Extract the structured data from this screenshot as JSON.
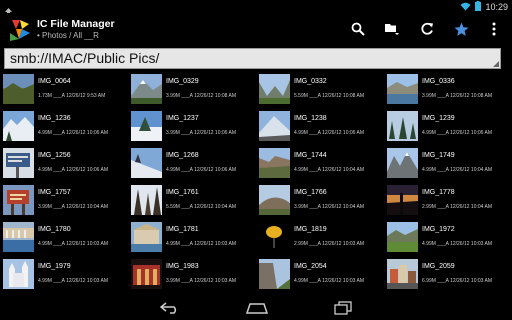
{
  "status": {
    "time": "10:29"
  },
  "app": {
    "title": "IC File Manager",
    "subtitle": "• Photos / All __R"
  },
  "icons": {
    "notification": "android-notification-icon",
    "wifi": "wifi-icon",
    "battery": "battery-icon",
    "logo": "ic-file-manager-logo",
    "search": "search-icon",
    "folder": "folder-menu-icon",
    "refresh": "refresh-icon",
    "favorite": "star-icon",
    "overflow": "overflow-menu-icon",
    "back": "back-icon",
    "home": "home-icon",
    "recents": "recent-apps-icon"
  },
  "colors": {
    "accent": "#33b5e5",
    "favorite": "#4a90e2"
  },
  "path": {
    "value": "smb://IMAC/Public Pics/"
  },
  "files": [
    {
      "name": "IMG_0064",
      "meta": "1.73M ___A 12/26/12 9:53 AM",
      "thumb": "landscape"
    },
    {
      "name": "IMG_0329",
      "meta": "3.99M ___A 12/26/12 10:08 AM",
      "thumb": "mountain"
    },
    {
      "name": "IMG_0332",
      "meta": "5.59M ___A 12/26/12 10:08 AM",
      "thumb": "valley"
    },
    {
      "name": "IMG_0336",
      "meta": "3.99M ___A 12/26/12 10:08 AM",
      "thumb": "lake"
    },
    {
      "name": "IMG_1236",
      "meta": "4.99M ___A 12/26/12 10:06 AM",
      "thumb": "snow"
    },
    {
      "name": "IMG_1237",
      "meta": "3.99M ___A 12/26/12 10:06 AM",
      "thumb": "snowtree"
    },
    {
      "name": "IMG_1238",
      "meta": "4.99M ___A 12/26/12 10:06 AM",
      "thumb": "snowpeak"
    },
    {
      "name": "IMG_1239",
      "meta": "4.99M ___A 12/26/12 10:06 AM",
      "thumb": "snowforest"
    },
    {
      "name": "IMG_1256",
      "meta": "4.99M ___A 12/26/12 10:06 AM",
      "thumb": "sign"
    },
    {
      "name": "IMG_1268",
      "meta": "4.99M ___A 12/26/12 10:06 AM",
      "thumb": "snowslope"
    },
    {
      "name": "IMG_1744",
      "meta": "4.99M ___A 12/26/12 10:04 AM",
      "thumb": "canyon"
    },
    {
      "name": "IMG_1749",
      "meta": "4.99M ___A 12/26/12 10:04 AM",
      "thumb": "peaks"
    },
    {
      "name": "IMG_1757",
      "meta": "3.99M ___A 12/26/12 10:04 AM",
      "thumb": "redsign"
    },
    {
      "name": "IMG_1761",
      "meta": "5.59M ___A 12/26/12 10:04 AM",
      "thumb": "forest"
    },
    {
      "name": "IMG_1766",
      "meta": "3.99M ___A 12/26/12 10:04 AM",
      "thumb": "hill"
    },
    {
      "name": "IMG_1778",
      "meta": "2.99M ___A 12/26/12 10:04 AM",
      "thumb": "sunset"
    },
    {
      "name": "IMG_1780",
      "meta": "4.99M ___A 12/26/12 10:03 AM",
      "thumb": "pool"
    },
    {
      "name": "IMG_1781",
      "meta": "4.99M ___A 12/26/12 10:03 AM",
      "thumb": "temple"
    },
    {
      "name": "IMG_1819",
      "meta": "2.99M ___A 12/26/12 10:03 AM",
      "thumb": "lamp"
    },
    {
      "name": "IMG_1972",
      "meta": "4.99M ___A 12/26/12 10:03 AM",
      "thumb": "meadow"
    },
    {
      "name": "IMG_1979",
      "meta": "4.99M ___A 12/26/12 10:03 AM",
      "thumb": "castle"
    },
    {
      "name": "IMG_1983",
      "meta": "3.99M ___A 12/26/12 10:03 AM",
      "thumb": "redhall"
    },
    {
      "name": "IMG_2054",
      "meta": "4.99M ___A 12/26/12 10:03 AM",
      "thumb": "cliff"
    },
    {
      "name": "IMG_2059",
      "meta": "6.99M ___A 12/26/12 10:03 AM",
      "thumb": "town"
    }
  ]
}
